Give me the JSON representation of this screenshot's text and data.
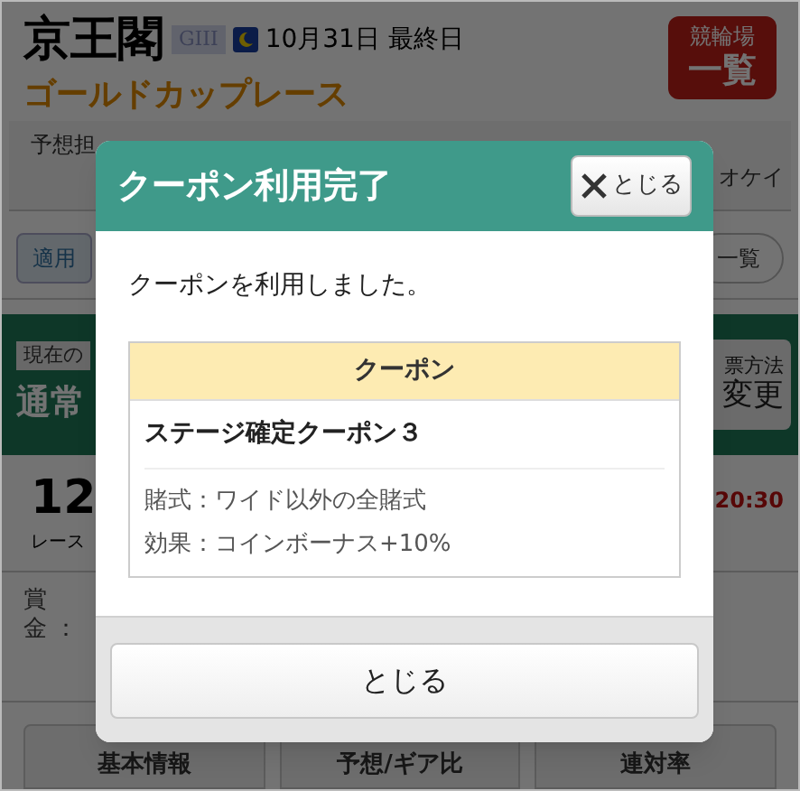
{
  "header": {
    "venue": "京王閣",
    "grade": "GIII",
    "date": "10月31日 最終日",
    "race_name": "ゴールドカップレース",
    "venue_list_button": [
      "競輪場",
      "一覧"
    ]
  },
  "reporter": {
    "label": "予想担",
    "name": "オケイ"
  },
  "filter": {
    "chip": "適用",
    "link": "一覧"
  },
  "mode": {
    "label": "現在の",
    "value": "通常",
    "button": [
      "票方法",
      "変更"
    ]
  },
  "race": {
    "number": "12",
    "unit": "レース",
    "time": "20:30"
  },
  "prize": {
    "label": [
      "賞",
      "金"
    ],
    "colon": "："
  },
  "tabs": [
    {
      "label": "基本情報",
      "selected": false
    },
    {
      "label": "予想/ギア比",
      "selected": false
    },
    {
      "label": "連対率",
      "selected": false
    }
  ],
  "dialog": {
    "title": "クーポン利用完了",
    "close_button": "とじる",
    "message": "クーポンを利用しました。",
    "coupon": {
      "header": "クーポン",
      "name": "ステージ確定クーポン３",
      "details": [
        "賭式：ワイド以外の全賭式",
        "効果：コインボーナス+10%"
      ]
    },
    "footer_button": "とじる"
  }
}
